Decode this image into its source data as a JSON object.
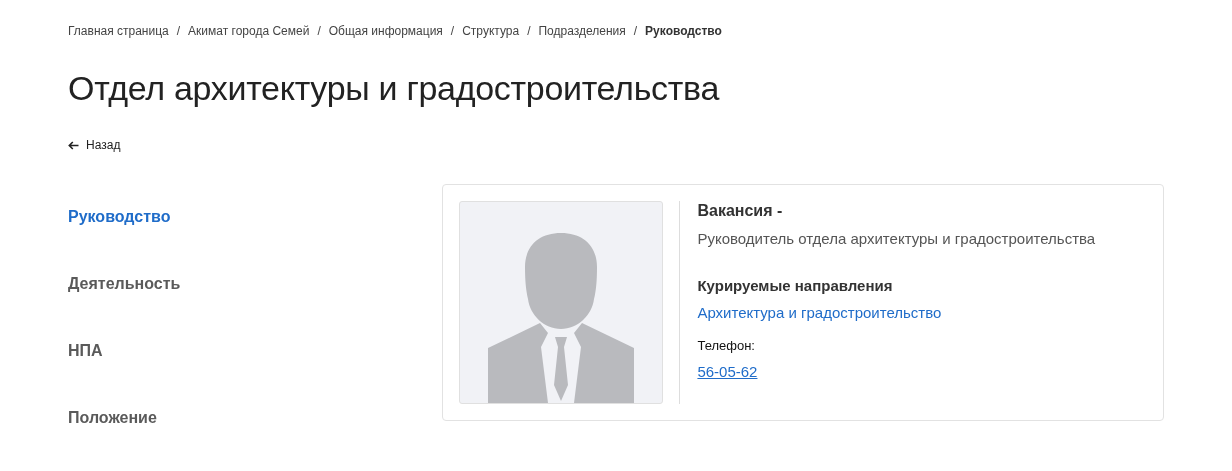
{
  "breadcrumbs": [
    {
      "label": "Главная страница",
      "current": false
    },
    {
      "label": "Акимат города Семей",
      "current": false
    },
    {
      "label": "Общая информация",
      "current": false
    },
    {
      "label": "Структура",
      "current": false
    },
    {
      "label": "Подразделения",
      "current": false
    },
    {
      "label": "Руководство",
      "current": true
    }
  ],
  "breadcrumb_separator": "/",
  "title": "Отдел архитектуры и градостроительства",
  "back_link": "Назад",
  "sidebar": {
    "items": [
      {
        "label": "Руководство",
        "selected": true
      },
      {
        "label": "Деятельность",
        "selected": false
      },
      {
        "label": "НПА",
        "selected": false
      },
      {
        "label": "Положение",
        "selected": false
      }
    ]
  },
  "person_card": {
    "photo": {
      "kind": "placeholder"
    },
    "name": "Вакансия -",
    "position": "Руководитель отдела архитектуры и градостроительства",
    "areas_heading": "Курируемые направления",
    "areas": [
      "Архитектура и градостроительство"
    ],
    "phone_label": "Телефон:",
    "phone": "56-05-62"
  }
}
